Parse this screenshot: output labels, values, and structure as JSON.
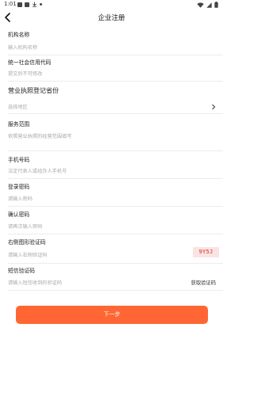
{
  "status_bar": {
    "time": "1:01"
  },
  "header": {
    "title": "企业注册"
  },
  "form": {
    "org_name": {
      "label": "机构名称",
      "placeholder": "输入机构名称"
    },
    "credit_code": {
      "label": "统一社会信用代码",
      "placeholder": "提交后不可修改"
    },
    "license_province": {
      "label": "营业执照登记省份",
      "placeholder": "选择地区"
    },
    "business_scope": {
      "label": "服务范围",
      "placeholder": "依照营业执照的经营范围填写"
    },
    "phone": {
      "label": "手机号码",
      "placeholder": "法定代表人或经办人手机号"
    },
    "password": {
      "label": "登录密码",
      "placeholder": "请输入密码"
    },
    "confirm_password": {
      "label": "确认密码",
      "placeholder": "请再次输入密码"
    },
    "image_captcha": {
      "label": "右侧图形验证码",
      "placeholder": "请输入右侧验证码",
      "captcha_text": "9Y5J"
    },
    "sms_code": {
      "label": "短信验证码",
      "placeholder": "请输入短信收到的验证码",
      "button": "获取验证码"
    }
  },
  "actions": {
    "next_label": "下一步"
  },
  "colors": {
    "accent": "#ff6633",
    "captcha_bg": "#fbe3e3",
    "placeholder": "#aaaaaa"
  }
}
